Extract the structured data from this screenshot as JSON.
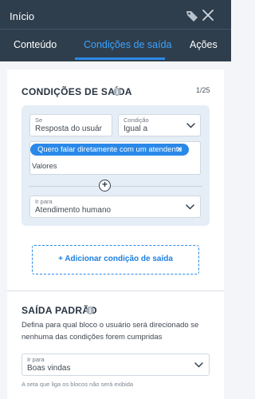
{
  "header": {
    "title": "Início"
  },
  "tabs": [
    {
      "label": "Conteúdo",
      "active": false
    },
    {
      "label": "Condições de saída",
      "active": true
    },
    {
      "label": "Ações",
      "active": false
    }
  ],
  "exit_conditions": {
    "title": "CONDIÇÕES DE SAÍDA",
    "counter": "1/25",
    "condition": {
      "if_label": "Se",
      "if_value": "Resposta do usuário",
      "operator_label": "Condição",
      "operator_value": "Igual a",
      "chip": "Quero falar diretamente com um atendente",
      "values_label": "Valores",
      "goto_label": "Ir para",
      "goto_value": "Atendimento humano"
    },
    "add_button": "+ Adicionar condição de saída"
  },
  "default_exit": {
    "title": "SAÍDA PADRÃO",
    "description": "Defina para qual bloco o usuário será direcionado se nenhuma das condições forem cumpridas",
    "goto_label": "Ir para",
    "goto_value": "Boas vindas",
    "hint": "A seta que liga os blocos não será exibida"
  },
  "colors": {
    "header_bg": "#2f3e4d",
    "accent": "#2a89e8",
    "card_bg": "#e5edf6"
  }
}
